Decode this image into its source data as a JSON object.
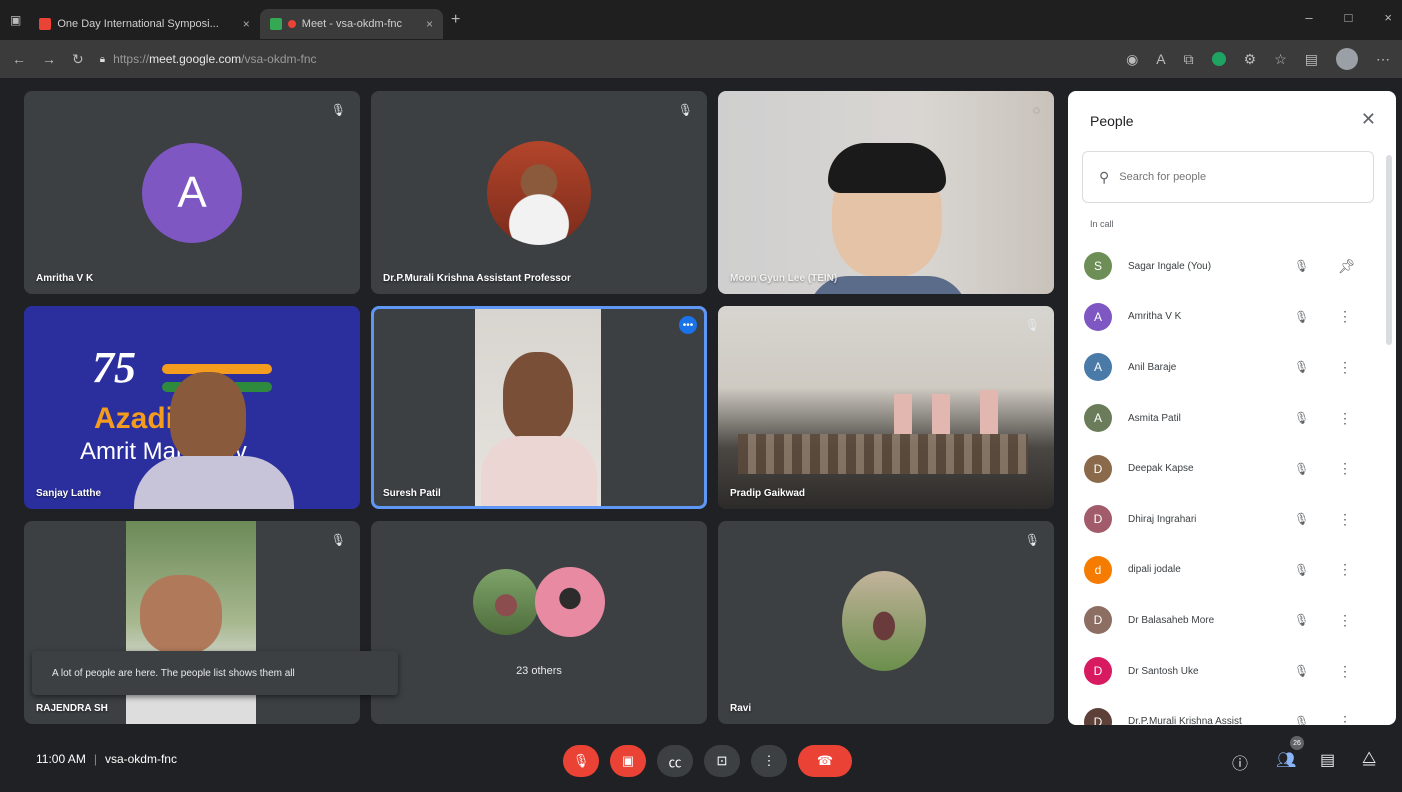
{
  "browser": {
    "tabs": [
      {
        "title": "One Day International Symposi...",
        "active": false,
        "favicon_color": "#ea4335"
      },
      {
        "title": "Meet - vsa-okdm-fnc",
        "active": true,
        "favicon_color": "#34a853"
      }
    ],
    "url_prefix": "https://",
    "url_host": "meet.google.com",
    "url_path": "/vsa-okdm-fnc"
  },
  "tiles": [
    {
      "name": "Amritha V K",
      "initial": "A",
      "avatar_color": "#7e57c2"
    },
    {
      "name": "Dr.P.Murali Krishna Assistant Professor"
    },
    {
      "name": "Moon Gyun Lee (TEIN)"
    },
    {
      "name": "Sanjay Latthe"
    },
    {
      "name": "Suresh Patil"
    },
    {
      "name": "Pradip Gaikwad"
    },
    {
      "name": "RAJENDRA SH"
    },
    {
      "name": "23 others"
    },
    {
      "name": "Ravi"
    }
  ],
  "banner": {
    "number": "75",
    "line1": "Azadi",
    "line2": "Amrit Mahotsav"
  },
  "toast": {
    "message": "A lot of people are here. The people list shows them all"
  },
  "people_panel": {
    "title": "People",
    "search_placeholder": "Search for people",
    "section_label": "In call",
    "participants": [
      {
        "name": "Sagar Ingale (You)",
        "avatar_color": "#6d8f57",
        "initial": "S"
      },
      {
        "name": "Amritha V K",
        "avatar_color": "#7e57c2",
        "initial": "A"
      },
      {
        "name": "Anil Baraje",
        "avatar_color": "#4a7aa8",
        "initial": "A"
      },
      {
        "name": "Asmita Patil",
        "avatar_color": "#6b7c5a",
        "initial": "A"
      },
      {
        "name": "Deepak Kapse",
        "avatar_color": "#8a6a4a",
        "initial": "D"
      },
      {
        "name": "Dhiraj Ingrahari",
        "avatar_color": "#a25b6b",
        "initial": "D"
      },
      {
        "name": "dipali jodale",
        "avatar_color": "#f57c00",
        "initial": "d"
      },
      {
        "name": "Dr Balasaheb More",
        "avatar_color": "#8d6e63",
        "initial": "D"
      },
      {
        "name": "Dr Santosh Uke",
        "avatar_color": "#d81b60",
        "initial": "D"
      },
      {
        "name": "Dr.P.Murali Krishna Assist",
        "avatar_color": "#5d4037",
        "initial": "D"
      }
    ]
  },
  "bottom": {
    "time": "11:00 AM",
    "meeting_code": "vsa-okdm-fnc",
    "people_count": "26"
  },
  "colors": {
    "accent": "#1a73e8",
    "danger": "#ea4335",
    "tile_bg": "#3c4043",
    "stage_bg": "#202124"
  }
}
